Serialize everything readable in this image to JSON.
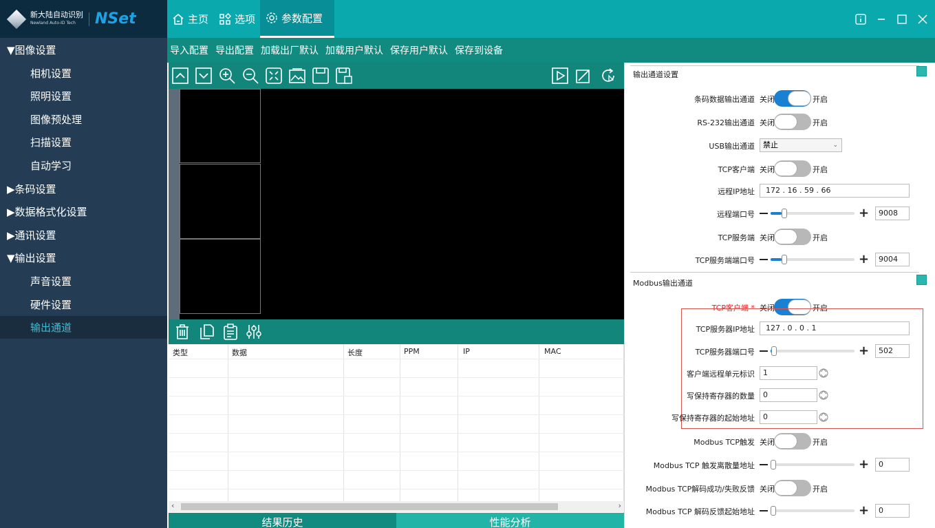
{
  "app": {
    "company": "新大陆自动识别",
    "company_en": "Newland Auto-ID Tech",
    "product": "NSet"
  },
  "nav_tabs": [
    {
      "label": "主页",
      "icon": "home-icon"
    },
    {
      "label": "选项",
      "icon": "grid-icon"
    },
    {
      "label": "参数配置",
      "icon": "gear-icon",
      "active": true
    }
  ],
  "window_controls": [
    "info-icon",
    "minimize-icon",
    "maximize-icon",
    "close-icon"
  ],
  "sidebar": [
    {
      "label": "▼图像设置",
      "kind": "group"
    },
    {
      "label": "相机设置",
      "kind": "sub"
    },
    {
      "label": "照明设置",
      "kind": "sub"
    },
    {
      "label": "图像预处理",
      "kind": "sub"
    },
    {
      "label": "扫描设置",
      "kind": "sub"
    },
    {
      "label": "自动学习",
      "kind": "sub"
    },
    {
      "label": "▶条码设置",
      "kind": "group"
    },
    {
      "label": "▶数据格式化设置",
      "kind": "group"
    },
    {
      "label": "▶通讯设置",
      "kind": "group"
    },
    {
      "label": "▼输出设置",
      "kind": "group"
    },
    {
      "label": "声音设置",
      "kind": "sub"
    },
    {
      "label": "硬件设置",
      "kind": "sub"
    },
    {
      "label": "输出通道",
      "kind": "sub",
      "active": true
    }
  ],
  "menubar": [
    "导入配置",
    "导出配置",
    "加载出厂默认",
    "加载用户默认",
    "保存用户默认",
    "保存到设备"
  ],
  "image_toolbar": [
    "chevron-up-icon",
    "chevron-down-icon",
    "zoom-in-icon",
    "zoom-out-icon",
    "fit-screen-icon",
    "image-icon",
    "save-icon",
    "save-as-icon",
    "play-icon",
    "crop-icon",
    "refresh-icon"
  ],
  "result_toolbar": [
    "trash-icon",
    "copy-icon",
    "clipboard-icon",
    "settings-sliders-icon"
  ],
  "result_table": {
    "columns": [
      "类型",
      "数据",
      "长度",
      "PPM",
      "IP",
      "MAC"
    ],
    "rows": []
  },
  "bottom_tabs": [
    "结果历史",
    "性能分析"
  ],
  "output_section": {
    "title": "输出通道设置",
    "barcode_output": {
      "label": "条码数据输出通道",
      "off": "关闭",
      "on": "开启",
      "state": "on"
    },
    "rs232": {
      "label": "RS-232输出通道",
      "off": "关闭",
      "on": "开启",
      "state": "off"
    },
    "usb": {
      "label": "USB输出通道",
      "value": "禁止"
    },
    "tcp_client": {
      "label": "TCP客户端",
      "off": "关闭",
      "on": "开启",
      "state": "off"
    },
    "remote_ip": {
      "label": "远程IP地址",
      "value": "172  .  16  .  59  .  66"
    },
    "remote_port": {
      "label": "远程端口号",
      "value": "9008",
      "level": 0.13
    },
    "tcp_server": {
      "label": "TCP服务端",
      "off": "关闭",
      "on": "开启",
      "state": "off"
    },
    "tcp_server_port": {
      "label": "TCP服务端端口号",
      "value": "9004",
      "level": 0.13
    }
  },
  "modbus_section": {
    "title": "Modbus输出通道",
    "tcp_client": {
      "label": "TCP客户端 *",
      "off": "关闭",
      "on": "开启",
      "state": "on"
    },
    "server_ip": {
      "label": "TCP服务器IP地址",
      "value": "127  .  0  .  0  .  1"
    },
    "server_port": {
      "label": "TCP服务器端口号",
      "value": "502",
      "level": 0.01
    },
    "unit_id": {
      "label": "客户端远程单元标识",
      "value": "1"
    },
    "holding_count": {
      "label": "写保持寄存器的数量",
      "value": "0"
    },
    "holding_addr": {
      "label": "写保持寄存器的起始地址",
      "value": "0"
    },
    "modbus_trigger": {
      "label": "Modbus TCP触发",
      "off": "关闭",
      "on": "开启",
      "state": "off"
    },
    "trigger_addr": {
      "label": "Modbus TCP 触发离散量地址",
      "value": "0",
      "level": 0
    },
    "feedback": {
      "label": "Modbus TCP解码成功/失败反馈",
      "off": "关闭",
      "on": "开启",
      "state": "off"
    },
    "feedback_addr": {
      "label": "Modbus TCP 解码反馈起始地址",
      "value": "0",
      "level": 0
    }
  },
  "colors": {
    "accent": "#0aa9ad",
    "sidebar": "#243d54",
    "toolbar": "#118b7f",
    "switch_on": "#1a80d1",
    "highlight_box": "#d9534f"
  }
}
